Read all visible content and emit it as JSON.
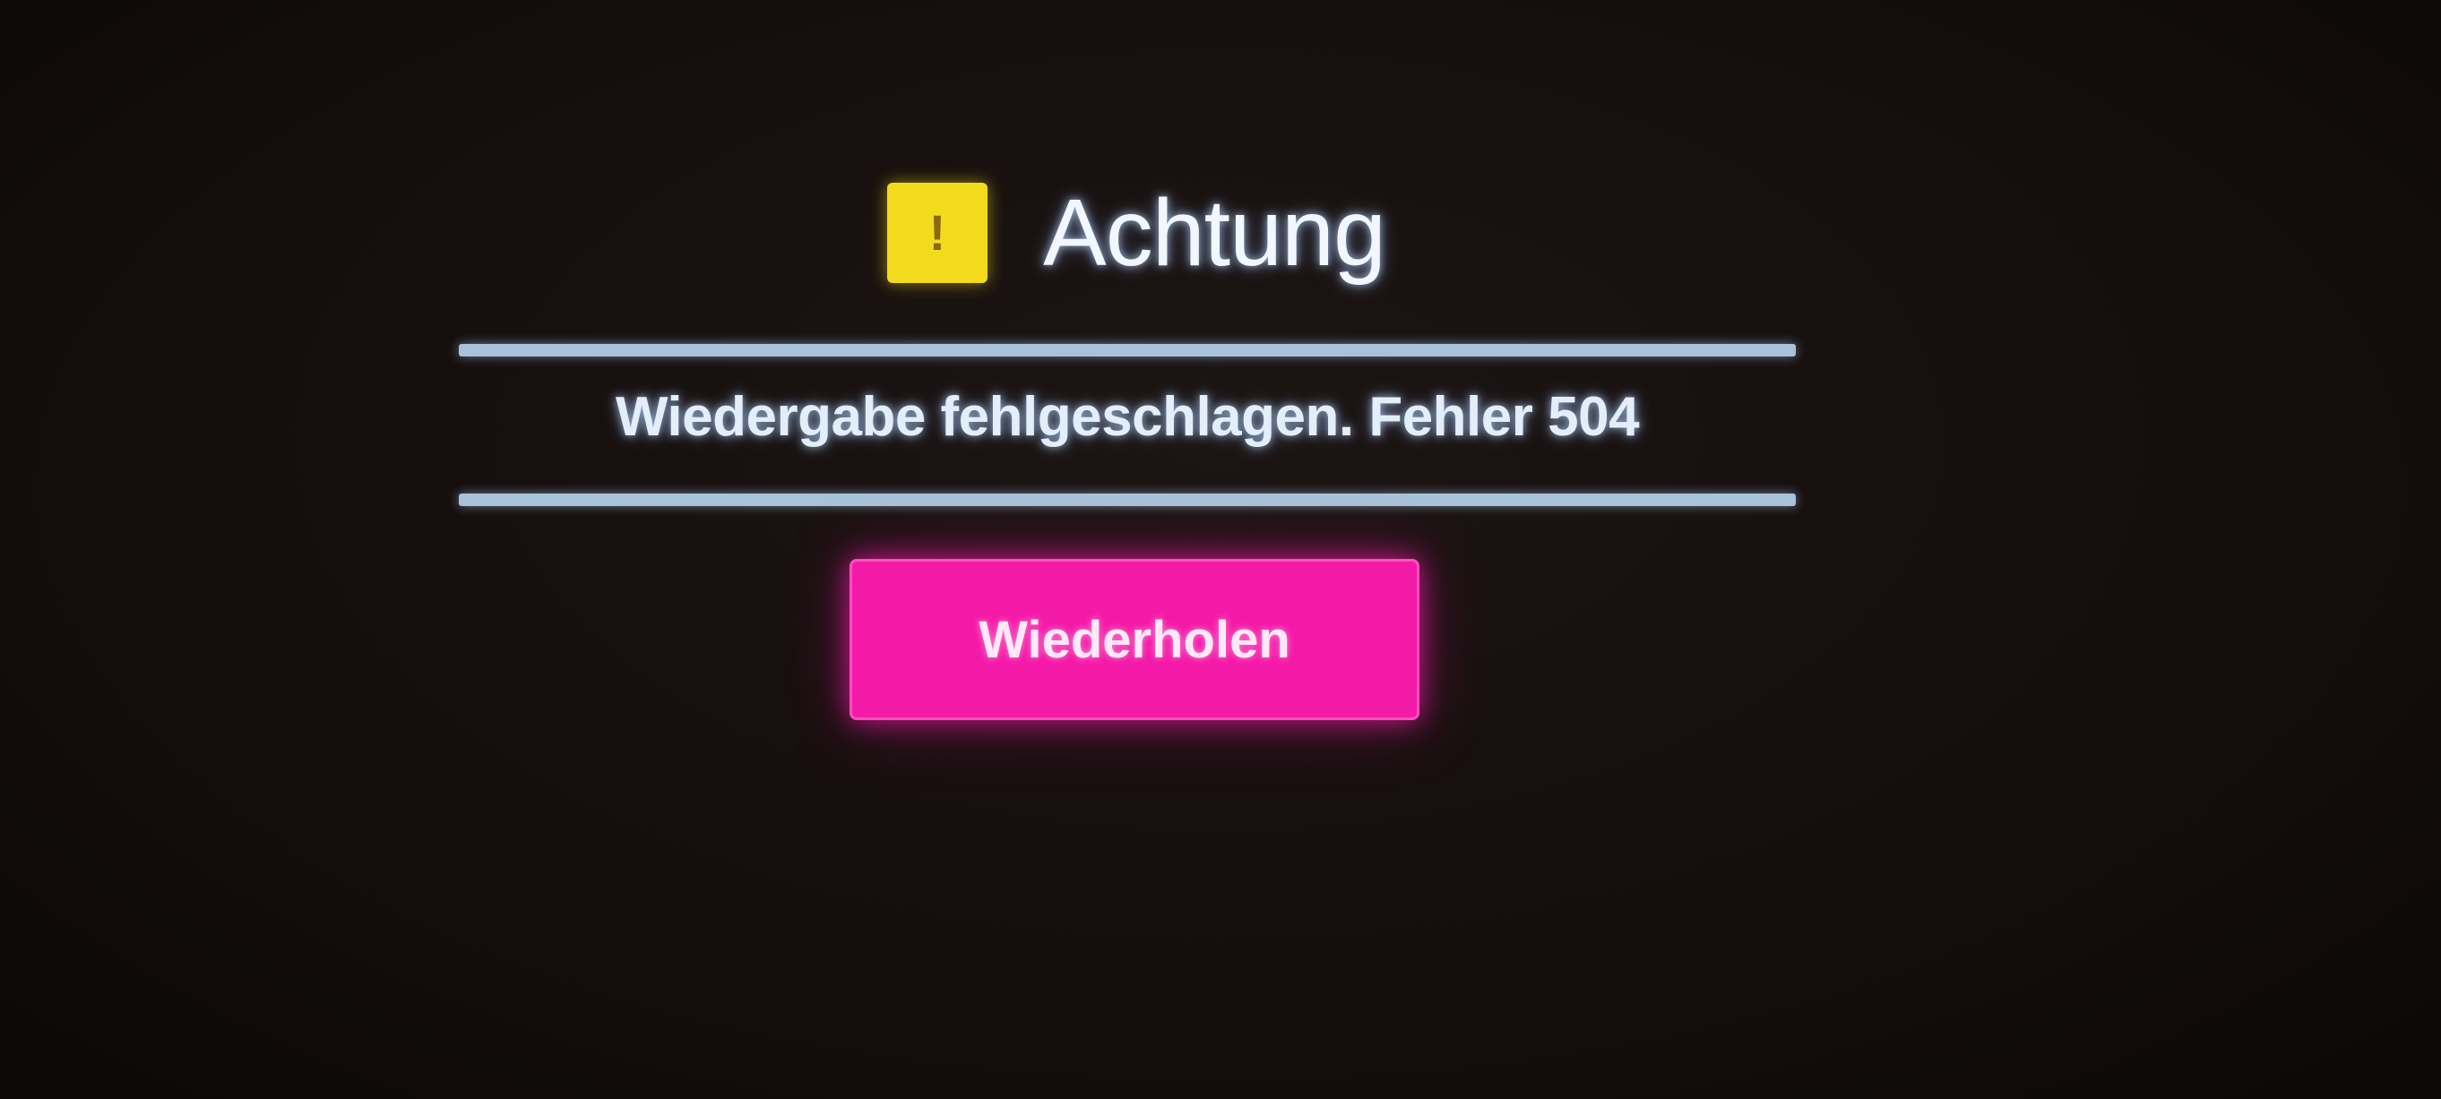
{
  "dialog": {
    "icon": "warning-icon",
    "icon_glyph": "!",
    "icon_color": "#f2db1c",
    "title": "Achtung",
    "message": "Wiedergabe fehlgeschlagen. Fehler 504",
    "retry_label": "Wiederholen",
    "accent_color": "#f41aa8",
    "divider_color": "#a9c2db"
  }
}
